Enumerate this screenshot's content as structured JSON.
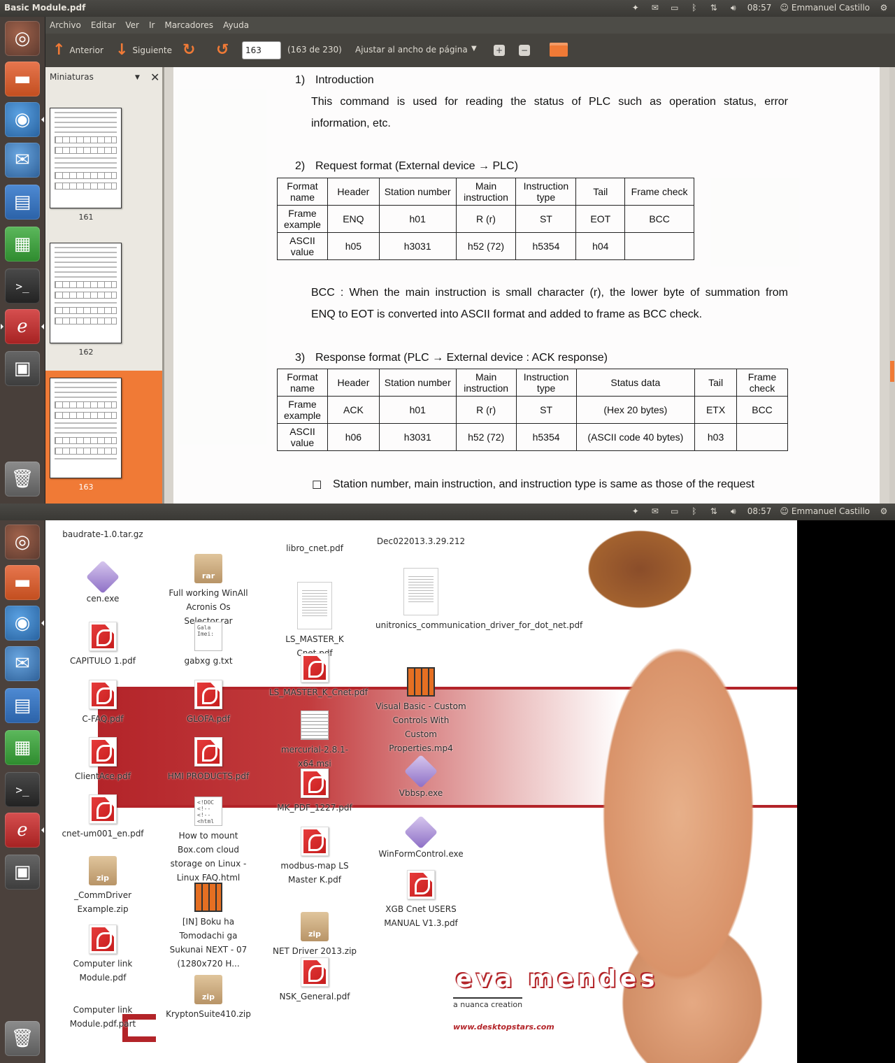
{
  "panel": {
    "window_title": "Basic Module.pdf",
    "clock": "08:57",
    "user": "Emmanuel Castillo"
  },
  "launcher": {
    "items": [
      {
        "name": "dash-home",
        "icon": "ubuntu-logo-icon"
      },
      {
        "name": "files",
        "icon": "folder-icon"
      },
      {
        "name": "firefox",
        "icon": "firefox-icon"
      },
      {
        "name": "thunderbird",
        "icon": "thunderbird-icon"
      },
      {
        "name": "writer",
        "icon": "writer-icon"
      },
      {
        "name": "calc",
        "icon": "calc-icon"
      },
      {
        "name": "terminal",
        "icon": "terminal-icon"
      },
      {
        "name": "evince",
        "icon": "document-viewer-icon"
      },
      {
        "name": "workspaces",
        "icon": "workspace-switcher-icon"
      },
      {
        "name": "trash",
        "icon": "trash-icon"
      }
    ]
  },
  "menubar": {
    "items": [
      "Archivo",
      "Editar",
      "Ver",
      "Ir",
      "Marcadores",
      "Ayuda"
    ]
  },
  "toolbar": {
    "prev_label": "Anterior",
    "next_label": "Siguiente",
    "page_value": "163",
    "page_count": "(163 de 230)",
    "zoom_label": "Ajustar al ancho de página"
  },
  "sidebar": {
    "title": "Miniaturas",
    "thumbnails": [
      {
        "label": "161"
      },
      {
        "label": "162"
      },
      {
        "label": "163"
      }
    ],
    "selected": "163"
  },
  "document": {
    "s1_num": "1)",
    "s1_title": "Introduction",
    "s1_text_line1": "This command is used for reading the status of PLC such as operation status, error",
    "s1_text_line2": "information, etc.",
    "s2_num": "2)",
    "s2_title": "Request format (External device → PLC)",
    "request_table": {
      "rows": [
        [
          "Format name",
          "Header",
          "Station number",
          "Main instruction",
          "Instruction type",
          "Tail",
          "Frame check"
        ],
        [
          "Frame example",
          "ENQ",
          "h01",
          "R (r)",
          "ST",
          "EOT",
          "BCC"
        ],
        [
          "ASCII value",
          "h05",
          "h3031",
          "h52 (72)",
          "h5354",
          "h04",
          ""
        ]
      ]
    },
    "bcc_line1": "BCC : When the main instruction is small character (r), the lower byte of summation from",
    "bcc_line2": "ENQ to EOT is converted into ASCII format and added to frame as BCC check.",
    "s3_num": "3)",
    "s3_title": "Response format (PLC → External device : ACK response)",
    "response_table": {
      "rows": [
        [
          "Format name",
          "Header",
          "Station number",
          "Main instruction",
          "Instruction type",
          "Status data",
          "Tail",
          "Frame check"
        ],
        [
          "Frame example",
          "ACK",
          "h01",
          "R (r)",
          "ST",
          "(Hex 20 bytes)",
          "ETX",
          "BCC"
        ],
        [
          "ASCII value",
          "h06",
          "h3031",
          "h52 (72)",
          "h5354",
          "(ASCII code 40 bytes)",
          "h03",
          ""
        ]
      ]
    },
    "note_bullet": "☐",
    "note_text": "Station number, main instruction, and instruction type is same as those of the request"
  },
  "desktop": {
    "brand": "eva mendes",
    "brand_sub": "a nuanca creation",
    "brand_url": "www.desktopstars.com",
    "icons": [
      {
        "label": "baudrate-1.0.tar.gz",
        "type": "none"
      },
      {
        "label": "cen.exe",
        "type": "exe"
      },
      {
        "label": "CAPITULO 1.pdf",
        "type": "pdf"
      },
      {
        "label": "C-FAQ.pdf",
        "type": "pdf"
      },
      {
        "label": "ClientAce.pdf",
        "type": "pdf"
      },
      {
        "label": "cnet-um001_en.pdf",
        "type": "pdf"
      },
      {
        "label": "_CommDriver Example.zip",
        "type": "zip"
      },
      {
        "label": "Computer link Module.pdf",
        "type": "pdf"
      },
      {
        "label": "Computer link Module.pdf.part",
        "type": "none"
      },
      {
        "label": "Full working WinAll Acronis Os Selector.rar",
        "type": "rar"
      },
      {
        "label": "gabxg g.txt",
        "type": "txt"
      },
      {
        "label": "GLOFA.pdf",
        "type": "pdf"
      },
      {
        "label": "HMI PRODUCTS.pdf",
        "type": "pdf"
      },
      {
        "label": "How to mount Box.com cloud storage on Linux - Linux FAQ.html",
        "type": "html"
      },
      {
        "label": "[IN] Boku ha Tomodachi ga Sukunai NEXT - 07 (1280x720 H...",
        "type": "video"
      },
      {
        "label": "KryptonSuite410.zip",
        "type": "zip"
      },
      {
        "label": "libro_cnet.pdf",
        "type": "none"
      },
      {
        "label": "LS_MASTER_K Cnet.pdf",
        "type": "thumbpdf"
      },
      {
        "label": "LS_MASTER_K_Cnet.pdf",
        "type": "pdf"
      },
      {
        "label": "mercurial-2.8.1-x64.msi",
        "type": "doc"
      },
      {
        "label": "MK_PDF_1227.pdf",
        "type": "pdf"
      },
      {
        "label": "modbus-map LS Master K.pdf",
        "type": "pdf"
      },
      {
        "label": "NET Driver 2013.zip",
        "type": "zip"
      },
      {
        "label": "NSK_General.pdf",
        "type": "pdf"
      },
      {
        "label": "Dec022013.3.29.212",
        "type": "none"
      },
      {
        "label": "unitronics_communication_driver_for_dot_net.pdf",
        "type": "thumbpdf"
      },
      {
        "label": "Visual Basic - Custom Controls With Custom Properties.mp4",
        "type": "video"
      },
      {
        "label": "Vbbsp.exe",
        "type": "exe"
      },
      {
        "label": "WinFormControl.exe",
        "type": "exe"
      },
      {
        "label": "XGB Cnet USERS MANUAL V1.3.pdf",
        "type": "pdf"
      }
    ]
  }
}
